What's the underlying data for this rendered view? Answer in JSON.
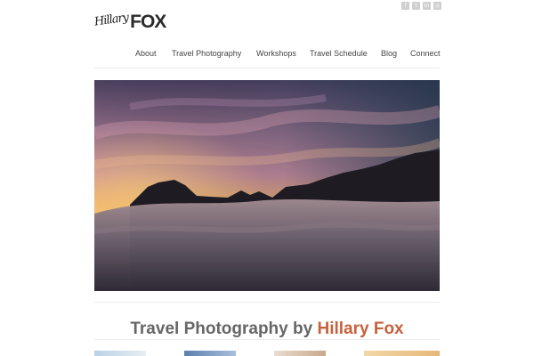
{
  "logo": {
    "script": "Hillary",
    "word": "FOX"
  },
  "social": [
    {
      "icon": "facebook-icon",
      "glyph": "f"
    },
    {
      "icon": "twitter-icon",
      "glyph": "t"
    },
    {
      "icon": "linkedin-icon",
      "glyph": "in"
    },
    {
      "icon": "instagram-icon",
      "glyph": "◎"
    }
  ],
  "nav": {
    "about": "About",
    "travel_photography": "Travel Photography",
    "workshops": "Workshops",
    "travel_schedule": "Travel Schedule",
    "blog": "Blog",
    "connect": "Connect"
  },
  "hero": {
    "description": "sunset over clouds"
  },
  "heading": {
    "prefix": "Travel Photography by ",
    "name": "Hillary Fox"
  },
  "colors": {
    "accent": "#c4623c",
    "nav_text": "#444444",
    "heading_text": "#666666"
  }
}
